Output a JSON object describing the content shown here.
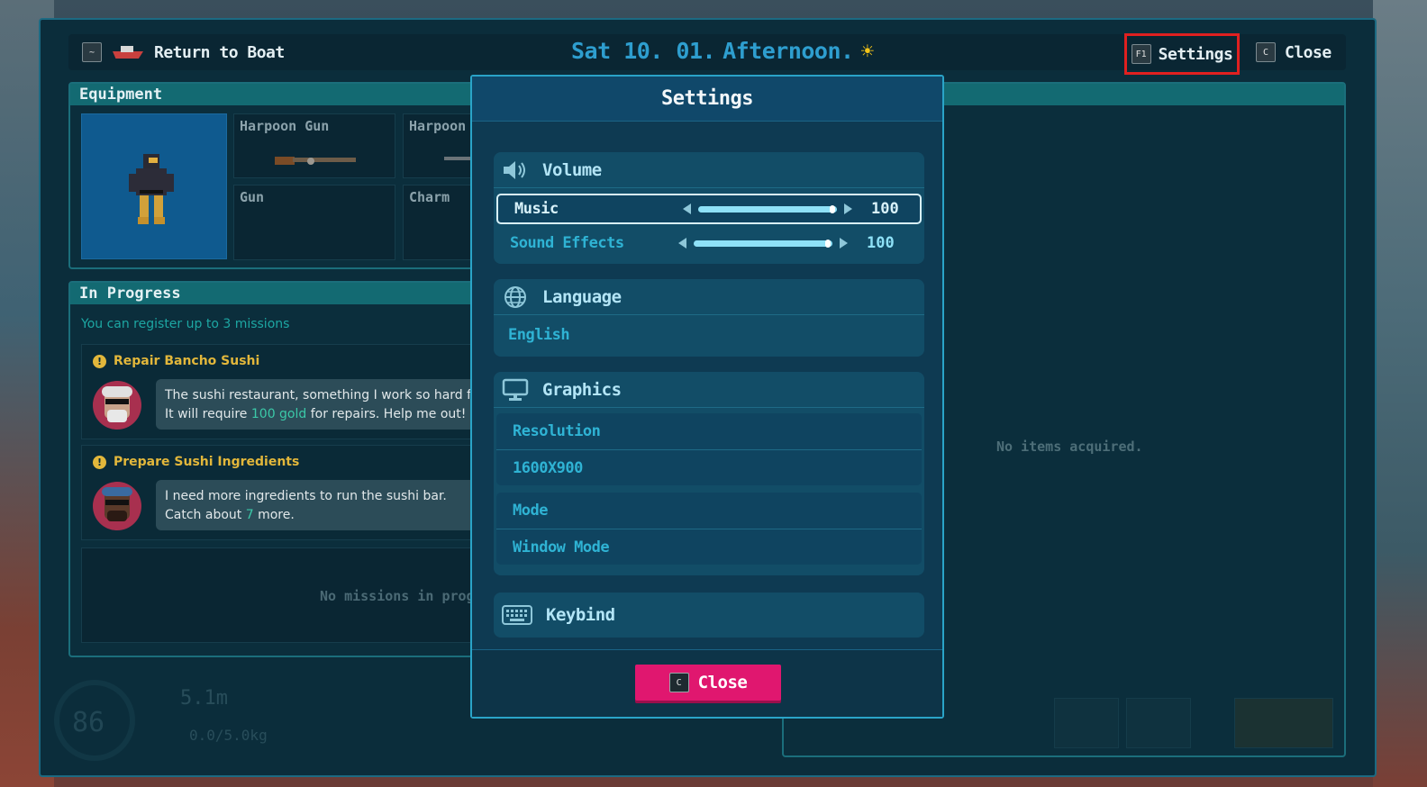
{
  "topbar": {
    "return_key": "~",
    "return_label": "Return to Boat",
    "date": "Sat 10. 01.",
    "time_of_day": "Afternoon.",
    "settings_key": "F1",
    "settings_label": "Settings",
    "close_key": "C",
    "close_label": "Close"
  },
  "equipment": {
    "title": "Equipment",
    "slots": [
      {
        "name": "Harpoon Gun"
      },
      {
        "name": "Harpoon"
      },
      {
        "name": "Gun"
      },
      {
        "name": "Charm"
      }
    ]
  },
  "in_progress": {
    "title": "In Progress",
    "hint": "You can register up to 3 missions",
    "missions": [
      {
        "title": "Repair Bancho Sushi",
        "line1": "The sushi restaurant, something I work so hard for",
        "line2_pre": "It will require ",
        "line2_hl": "100 gold",
        "line2_post": " for repairs. Help me out!"
      },
      {
        "title": "Prepare Sushi Ingredients",
        "line1": "I need more ingredients to run the sushi bar.",
        "line2_pre": "Catch about ",
        "line2_hl": "7",
        "line2_post": " more."
      }
    ],
    "empty": "No missions in progress"
  },
  "right_panel": {
    "empty": "No items acquired."
  },
  "hud": {
    "oxygen": "86",
    "depth": "5.1m",
    "weight": "0.0/5.0kg"
  },
  "settings": {
    "title": "Settings",
    "volume": {
      "title": "Volume",
      "music_label": "Music",
      "music_value": "100",
      "music_level": 1.0,
      "sfx_label": "Sound Effects",
      "sfx_value": "100",
      "sfx_level": 1.0
    },
    "language": {
      "title": "Language",
      "value": "English"
    },
    "graphics": {
      "title": "Graphics",
      "resolution_label": "Resolution",
      "resolution_value": "1600X900",
      "mode_label": "Mode",
      "mode_value": "Window Mode"
    },
    "keybind": {
      "title": "Keybind"
    },
    "close_key": "C",
    "close_label": "Close"
  },
  "colors": {
    "accent": "#2aa4c8",
    "close_button": "#e0176f",
    "highlight_box": "#e02020",
    "mission_title": "#e2b73b",
    "hint": "#1da7a3"
  }
}
